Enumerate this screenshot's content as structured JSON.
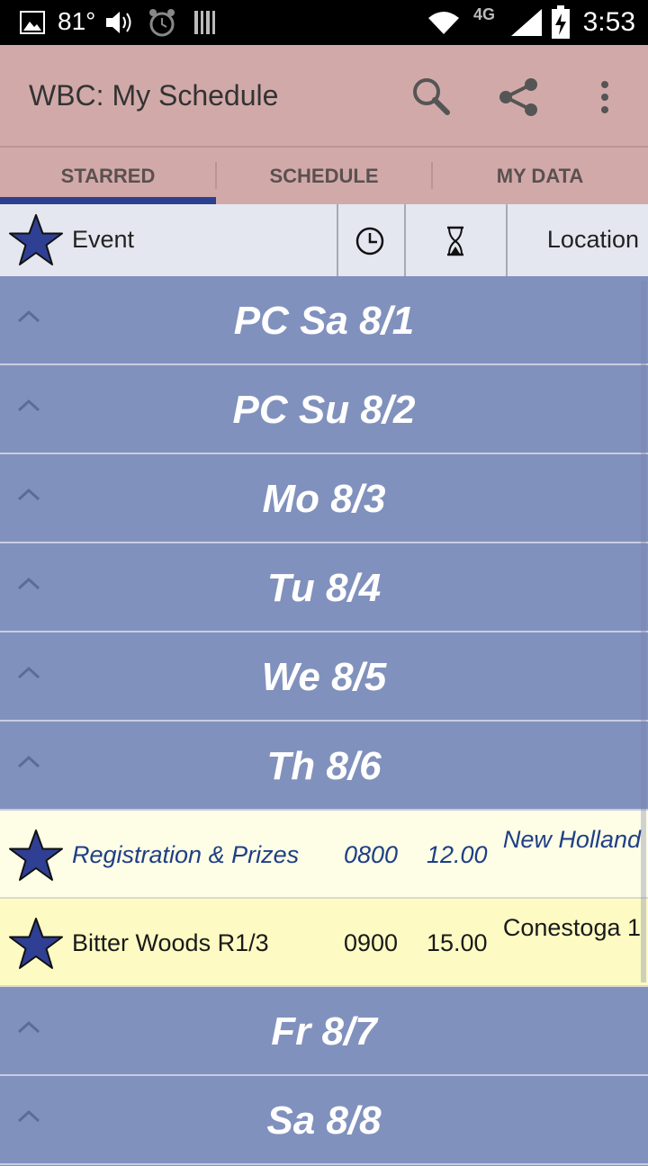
{
  "status_bar": {
    "temperature": "81°",
    "network": "4G",
    "time": "3:53"
  },
  "action_bar": {
    "title": "WBC: My Schedule",
    "icons": [
      "search-icon",
      "share-icon",
      "overflow-menu-icon"
    ]
  },
  "tabs": [
    {
      "label": "STARRED",
      "selected": true
    },
    {
      "label": "SCHEDULE",
      "selected": false
    },
    {
      "label": "MY DATA",
      "selected": false
    }
  ],
  "columns": {
    "event": "Event",
    "location": "Location",
    "time_icon": "clock-icon",
    "duration_icon": "hourglass-icon"
  },
  "days": [
    "PC Sa 8/1",
    "PC Su 8/2",
    "Mo 8/3",
    "Tu 8/4",
    "We 8/5",
    "Th 8/6",
    "Fr 8/7",
    "Sa 8/8"
  ],
  "events": [
    {
      "name": "Registration & Prizes",
      "time": "0800",
      "duration": "12.00",
      "location": "New Holland",
      "starred": true
    },
    {
      "name": "Bitter Woods R1/3",
      "time": "0900",
      "duration": "15.00",
      "location": "Conestoga 1",
      "starred": true
    }
  ],
  "colors": {
    "action_bar": "#d2a9a9",
    "day_row": "#8191bd",
    "star": "#2f3f93",
    "tab_indicator": "#2d3f8f"
  }
}
